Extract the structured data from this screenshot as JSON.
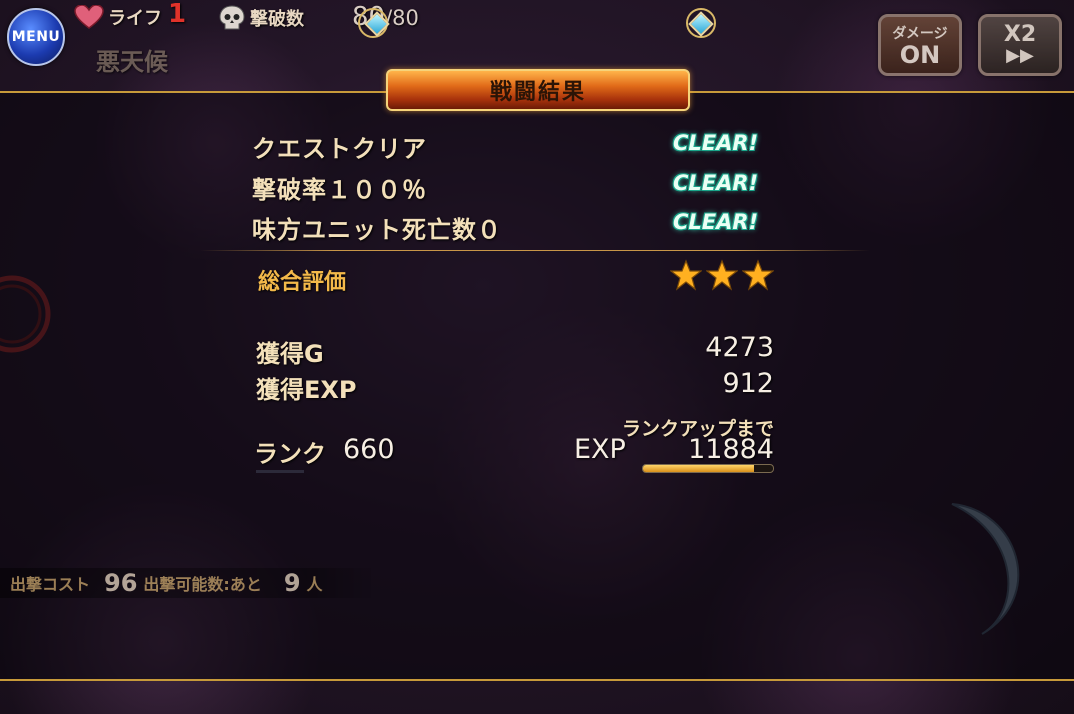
{
  "hud": {
    "menu_label": "MENU",
    "life_label": "ライフ",
    "life_value": "1",
    "kills_label": "撃破数",
    "kills_current": "80",
    "kills_total": "/80",
    "weather_label": "悪天候",
    "damage_toggle": {
      "line1": "ダメージ",
      "line2": "ON"
    },
    "speed_toggle": {
      "line1": "X2",
      "line2": "▶▶"
    }
  },
  "result": {
    "title": "戦闘結果",
    "conditions": [
      {
        "label": "クエストクリア",
        "status": "CLEAR!"
      },
      {
        "label": "撃破率１００％",
        "status": "CLEAR!"
      },
      {
        "label": "味方ユニット死亡数０",
        "status": "CLEAR!"
      }
    ],
    "overall_label": "総合評価",
    "stars": 3,
    "gold_label": "獲得G",
    "gold_value": "4273",
    "exp_label": "獲得EXP",
    "exp_value": "912",
    "rank_label": "ランク",
    "rank_value": "660",
    "rankup_label": "ランクアップまで",
    "rankup_exp_label": "EXP",
    "rankup_exp_value": "11884",
    "rankup_progress": 0.85
  },
  "footer": {
    "cost_label": "出撃コスト",
    "cost_value": "96",
    "deploy_label": "出撃可能数:あと",
    "deploy_value": "9",
    "deploy_unit": "人"
  },
  "colors": {
    "accent_gold": "#c79a3a",
    "clear_teal": "#3de0c0",
    "title_orange": "#e06a18",
    "star_gold": "#ffb020"
  }
}
